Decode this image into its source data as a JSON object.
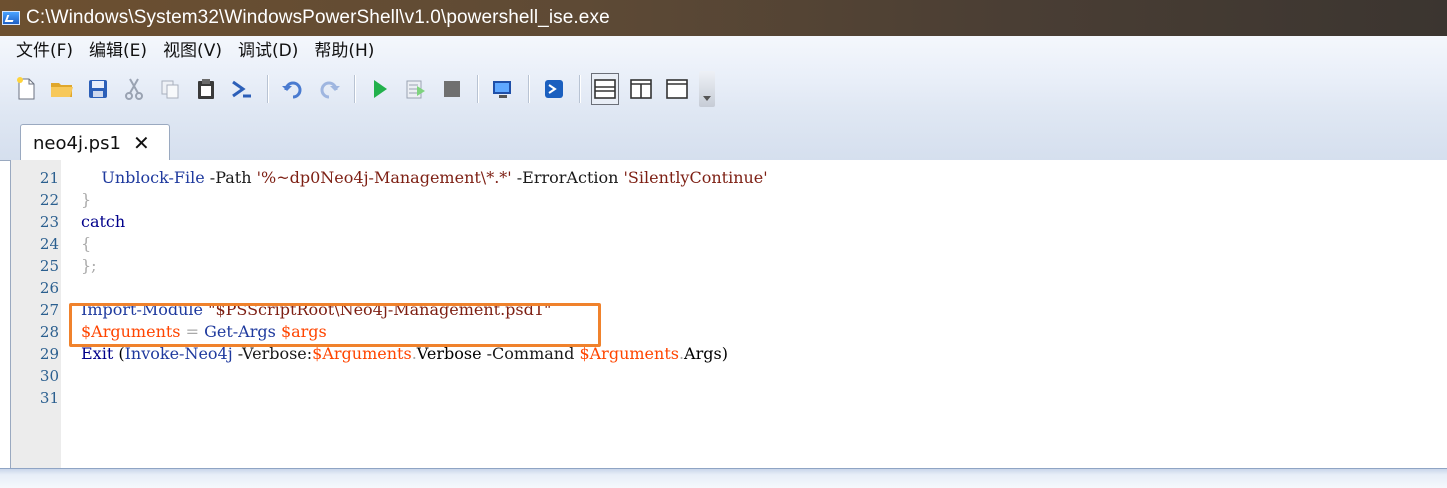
{
  "window": {
    "title": "C:\\Windows\\System32\\WindowsPowerShell\\v1.0\\powershell_ise.exe",
    "icon": "powershell-icon"
  },
  "menu": {
    "items": [
      {
        "label": "文件(F)"
      },
      {
        "label": "编辑(E)"
      },
      {
        "label": "视图(V)"
      },
      {
        "label": "调试(D)"
      },
      {
        "label": "帮助(H)"
      }
    ]
  },
  "toolbar": {
    "buttons": [
      "new-file-icon",
      "open-folder-icon",
      "save-icon",
      "cut-icon",
      "copy-icon",
      "paste-icon",
      "clear-console-icon",
      "undo-icon",
      "redo-icon",
      "run-icon",
      "run-selection-icon",
      "stop-icon",
      "remote-powershell-icon",
      "powershell-console-icon",
      "layout-top-icon",
      "layout-right-icon",
      "layout-maximize-icon"
    ]
  },
  "tabs": [
    {
      "label": "neo4j.ps1",
      "close": "✕",
      "active": true
    }
  ],
  "editor": {
    "lines": [
      {
        "num": "21",
        "tokens": [
          {
            "t": "    ",
            "c": "t-plain"
          },
          {
            "t": "Unblock-File",
            "c": "t-cmd"
          },
          {
            "t": " -Path ",
            "c": "t-param"
          },
          {
            "t": "'%~dp0Neo4j-Management\\*.*'",
            "c": "t-str"
          },
          {
            "t": " -ErrorAction ",
            "c": "t-param"
          },
          {
            "t": "'SilentlyContinue'",
            "c": "t-str"
          }
        ]
      },
      {
        "num": "22",
        "tokens": [
          {
            "t": "}",
            "c": "t-op"
          }
        ]
      },
      {
        "num": "23",
        "tokens": [
          {
            "t": "catch",
            "c": "t-key"
          }
        ]
      },
      {
        "num": "24",
        "tokens": [
          {
            "t": "{",
            "c": "t-op"
          }
        ]
      },
      {
        "num": "25",
        "tokens": [
          {
            "t": "};",
            "c": "t-op"
          }
        ]
      },
      {
        "num": "26",
        "tokens": []
      },
      {
        "num": "27",
        "tokens": [
          {
            "t": "Import-Module",
            "c": "t-cmd"
          },
          {
            "t": " ",
            "c": "t-plain"
          },
          {
            "t": "\"$PSScriptRoot\\Neo4j-Management.psd1\"",
            "c": "t-str"
          }
        ]
      },
      {
        "num": "28",
        "tokens": [
          {
            "t": "$Arguments",
            "c": "t-var"
          },
          {
            "t": " = ",
            "c": "t-op"
          },
          {
            "t": "Get-Args",
            "c": "t-cmd"
          },
          {
            "t": " ",
            "c": "t-plain"
          },
          {
            "t": "$args",
            "c": "t-var"
          }
        ]
      },
      {
        "num": "29",
        "tokens": [
          {
            "t": "Exit",
            "c": "t-key"
          },
          {
            "t": " (",
            "c": "t-plain"
          },
          {
            "t": "Invoke-Neo4j",
            "c": "t-cmd"
          },
          {
            "t": " -Verbose:",
            "c": "t-param"
          },
          {
            "t": "$Arguments",
            "c": "t-var"
          },
          {
            "t": ".",
            "c": "t-op"
          },
          {
            "t": "Verbose",
            "c": "t-prop"
          },
          {
            "t": " -Command ",
            "c": "t-param"
          },
          {
            "t": "$Arguments",
            "c": "t-var"
          },
          {
            "t": ".",
            "c": "t-op"
          },
          {
            "t": "Args",
            "c": "t-prop"
          },
          {
            "t": ")",
            "c": "t-plain"
          }
        ]
      },
      {
        "num": "30",
        "tokens": []
      },
      {
        "num": "31",
        "tokens": []
      }
    ],
    "highlight_color": "#f0822c"
  }
}
